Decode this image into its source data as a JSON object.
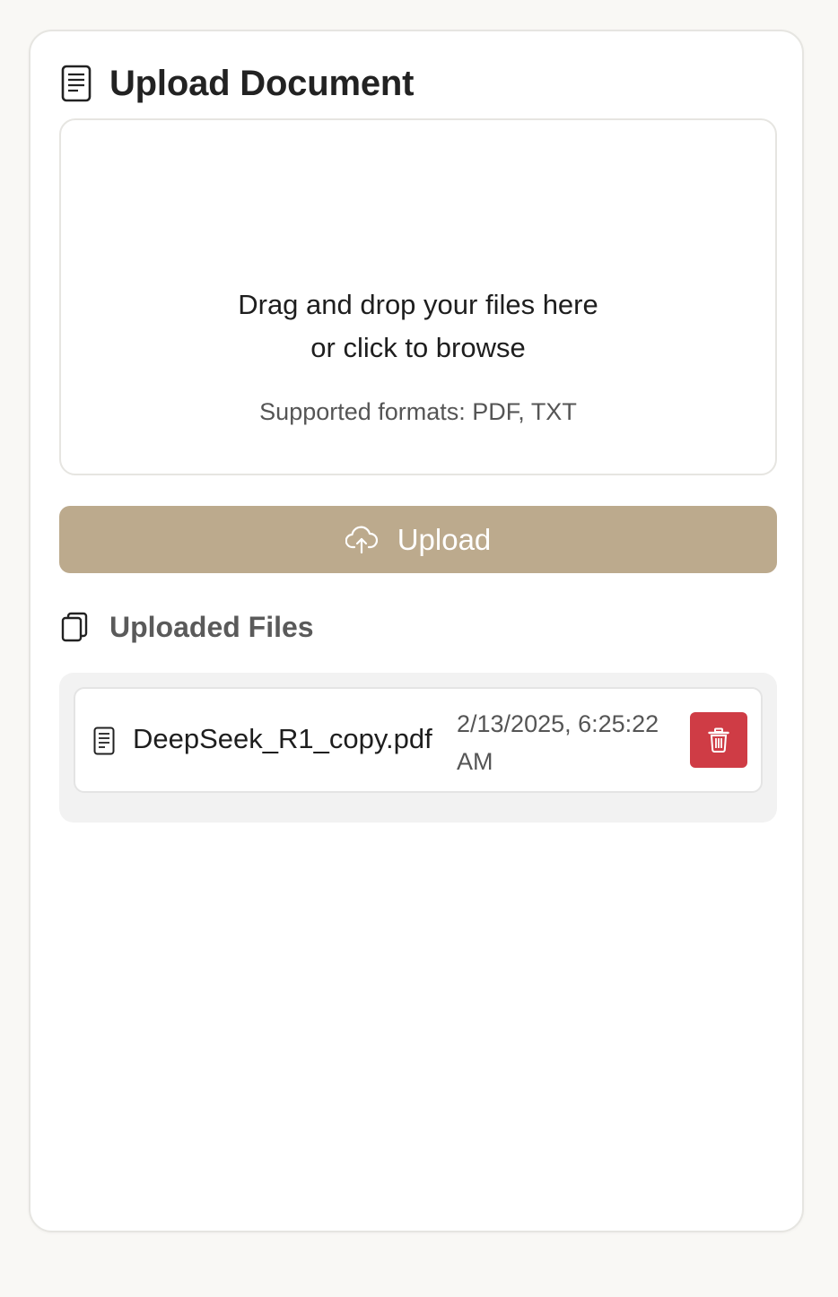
{
  "header": {
    "icon": "document-icon",
    "title": "Upload Document"
  },
  "dropzone": {
    "line1": "Drag and drop your files here",
    "line2": "or click to browse",
    "formats": "Supported formats: PDF, TXT"
  },
  "upload_button": {
    "icon": "cloud-upload-icon",
    "label": "Upload",
    "color": "#bcaa8d"
  },
  "uploaded_files": {
    "icon": "files-copy-icon",
    "title": "Uploaded Files",
    "items": [
      {
        "icon": "document-icon",
        "name": "DeepSeek_R1_copy.pdf",
        "date": "2/13/2025, 6:25:22 AM",
        "delete_icon": "trash-icon",
        "delete_color": "#cf3c45"
      }
    ]
  }
}
